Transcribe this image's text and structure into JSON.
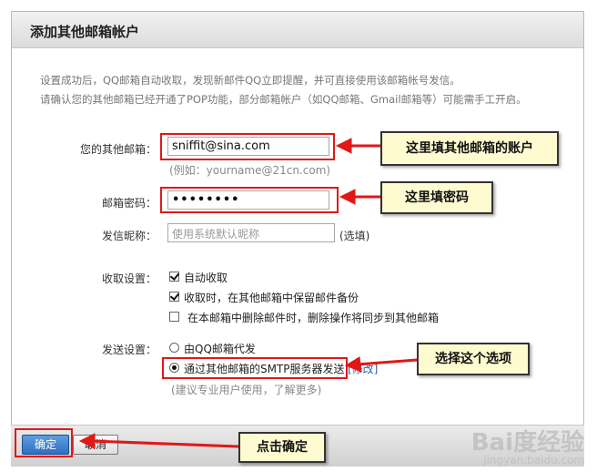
{
  "dialog": {
    "title": "添加其他邮箱帐户",
    "info_line1": "设置成功后，QQ邮箱自动收取，发现新邮件QQ立即提醒，并可直接使用该邮箱帐号发信。",
    "info_line2": "请确认您的其他邮箱已经开通了POP功能，部分邮箱帐户（如QQ邮箱、Gmail邮箱等）可能需手工开启。"
  },
  "form": {
    "email_label": "您的其他邮箱：",
    "email_value": "sniffit@sina.com",
    "email_example": "(例如：yourname@21cn.com)",
    "password_label": "邮箱密码：",
    "password_value": "••••••••",
    "nickname_label": "发信昵称：",
    "nickname_placeholder": "使用系统默认昵称",
    "nickname_optional": "(选填)",
    "receive_label": "收取设置：",
    "receive_options": [
      {
        "label": "自动收取",
        "checked": true
      },
      {
        "label": "收取时，在其他邮箱中保留邮件备份",
        "checked": true
      },
      {
        "label": "在本邮箱中删除邮件时，删除操作将同步到其他邮箱",
        "checked": false
      }
    ],
    "send_label": "发送设置：",
    "send_options": [
      {
        "label": "由QQ邮箱代发",
        "checked": false
      },
      {
        "label": "通过其他邮箱的SMTP服务器发送",
        "extra": "[修改]",
        "checked": true
      }
    ],
    "send_hint": "(建议专业用户使用，了解更多)"
  },
  "footer": {
    "ok_label": "确定",
    "cancel_label": "取消"
  },
  "annotations": {
    "email_callout": "这里填其他邮箱的账户",
    "password_callout": "这里填密码",
    "option_callout": "选择这个选项",
    "ok_callout": "点击确定",
    "highlight_color": "#e01818",
    "callout_bg": "#fffbd0"
  },
  "watermark": {
    "logo": "Bai度经验",
    "sub": "jingyan.baidu.com"
  }
}
